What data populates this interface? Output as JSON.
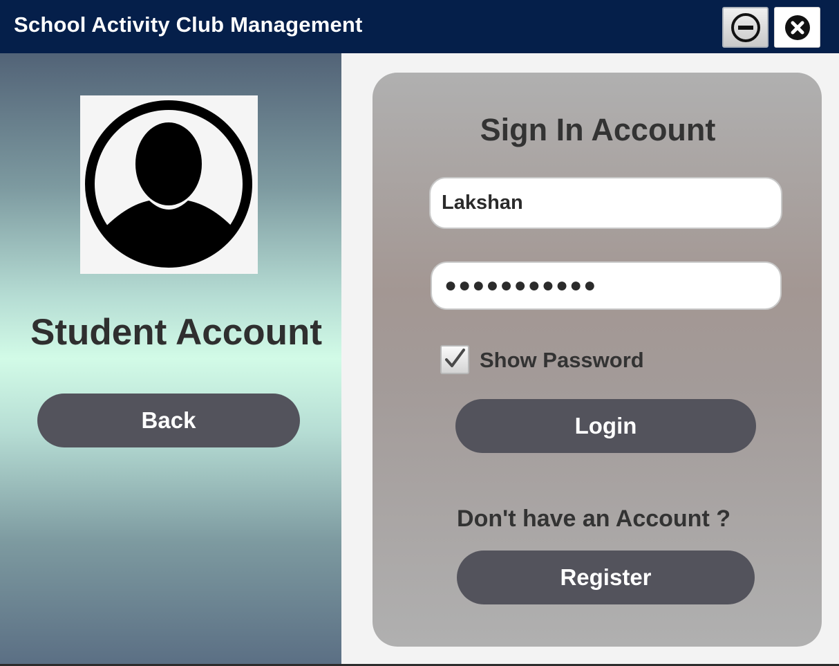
{
  "window": {
    "title": "School Activity Club Management",
    "minimize_icon": "minimize-circle-icon",
    "close_icon": "close-circle-icon"
  },
  "left_panel": {
    "avatar_icon": "user-avatar-icon",
    "account_type": "Student Account",
    "back_label": "Back"
  },
  "login_card": {
    "title": "Sign In Account",
    "username_value": "Lakshan",
    "password_masked": "●●●●●●●●●●●",
    "show_password_label": "Show Password",
    "show_password_checked": true,
    "login_label": "Login",
    "register_prompt": "Don't have an Account ?",
    "register_label": "Register"
  },
  "colors": {
    "titlebar": "#051f4a",
    "button": "#53535c",
    "text_dark": "#333333"
  }
}
